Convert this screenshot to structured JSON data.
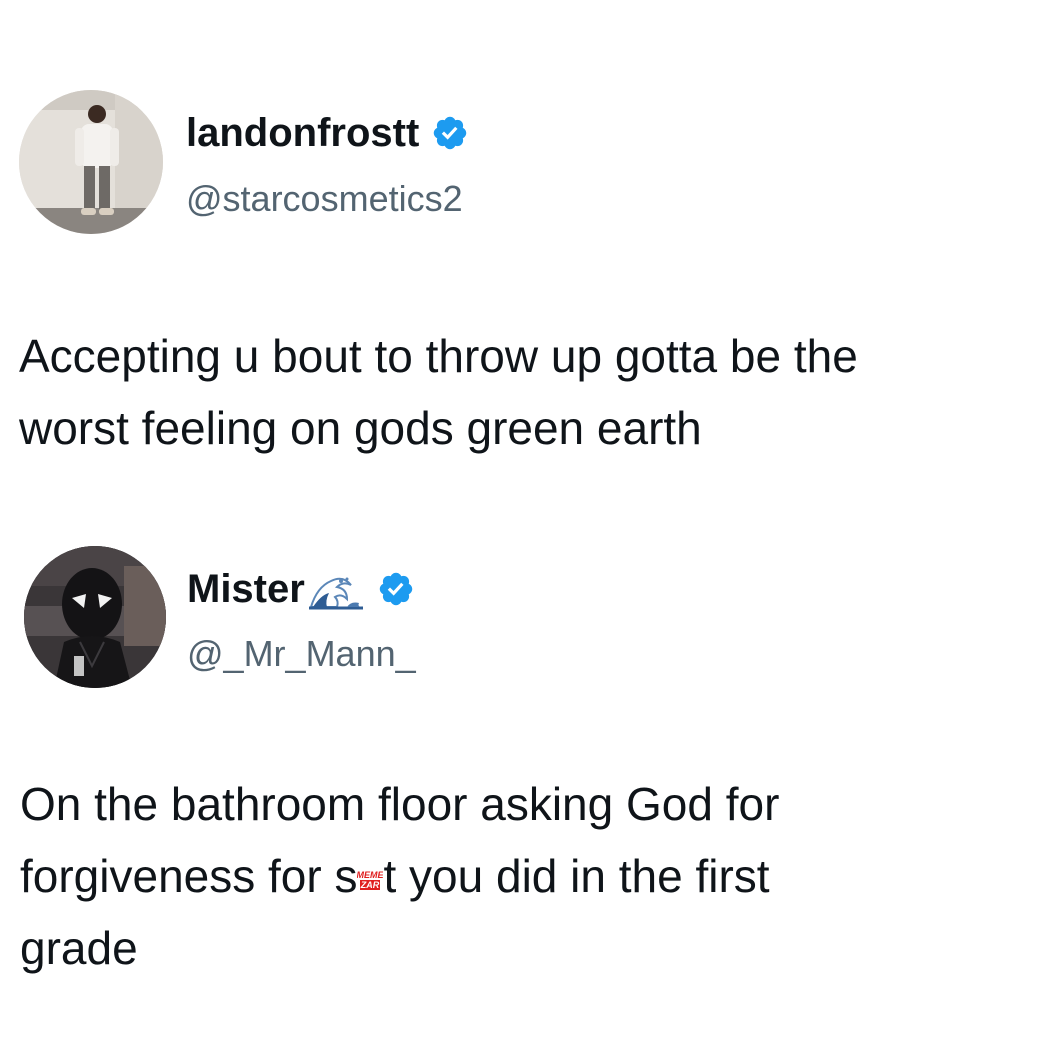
{
  "tweets": [
    {
      "display_name": "landonfrostt",
      "handle": "@starcosmetics2",
      "verified": true,
      "text_lines": [
        "Accepting u bout to throw up gotta be the",
        "worst feeling on gods green earth"
      ]
    },
    {
      "display_name": "Mister",
      "name_emoji": "wave-emoji",
      "handle": "@_Mr_Mann_",
      "verified": true,
      "text_lines": [
        "On the bathroom floor asking God for",
        {
          "before": "forgiveness for s",
          "after": "t you did in the first"
        },
        "grade"
      ]
    }
  ],
  "watermark": {
    "line1": "MEME",
    "line2": "ZAR"
  },
  "colors": {
    "text": "#0f1419",
    "handle": "#536471",
    "verified": "#1d9bf0",
    "background": "#ffffff"
  }
}
